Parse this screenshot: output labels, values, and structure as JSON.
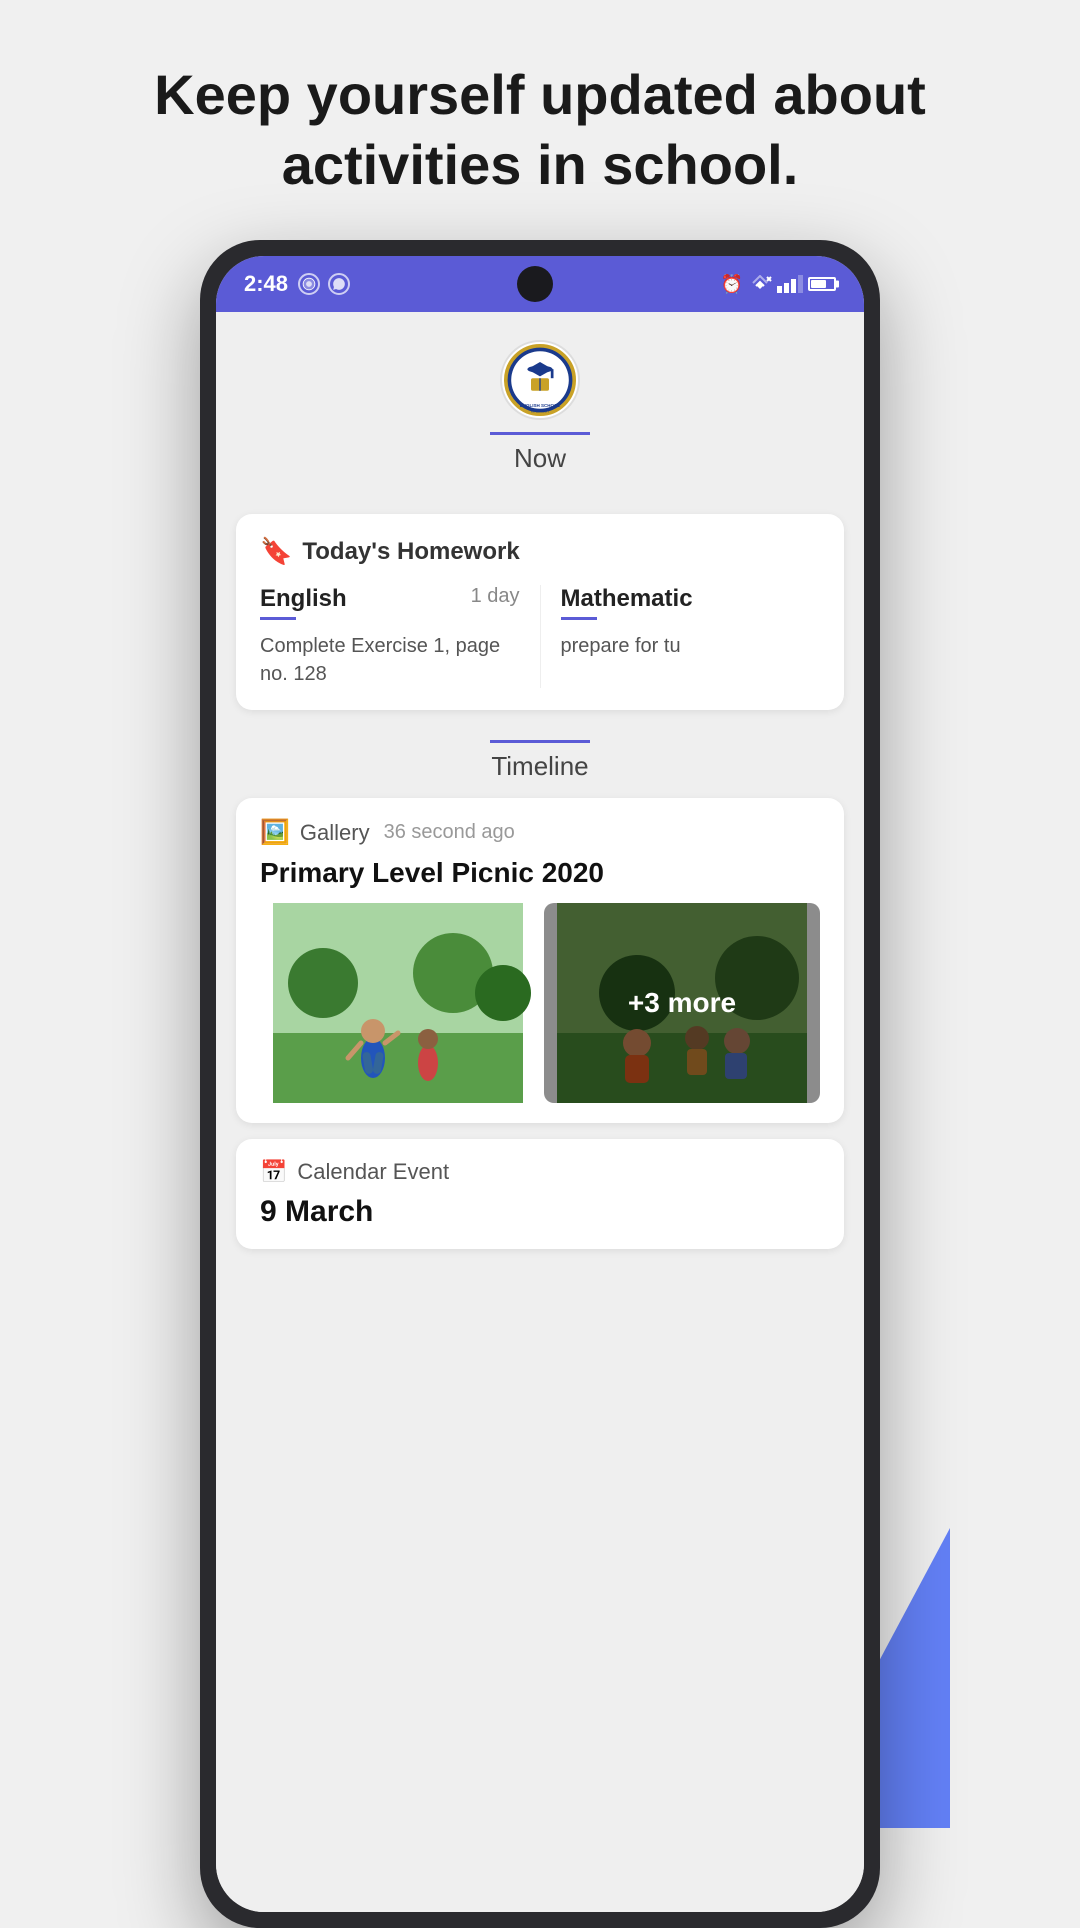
{
  "hero": {
    "text": "Keep yourself updated about activities in school."
  },
  "statusBar": {
    "time": "2:48",
    "icons": [
      "messaging-icon",
      "whatsapp-icon"
    ],
    "rightIcons": [
      "alarm-icon",
      "wifi-icon",
      "signal-icon",
      "battery-icon"
    ]
  },
  "schoolHeader": {
    "logoAlt": "School logo",
    "tabLabel": "Now"
  },
  "homeworkSection": {
    "title": "Today's Homework",
    "subjects": [
      {
        "name": "English",
        "days": "1 day",
        "description": "Complete Exercise 1, page no. 128"
      },
      {
        "name": "Mathematic",
        "days": "",
        "description": "prepare for tu"
      }
    ]
  },
  "timelineSection": {
    "tabLabel": "Timeline",
    "cards": [
      {
        "type": "Gallery",
        "timeAgo": "36 second ago",
        "title": "Primary Level Picnic 2020",
        "moreCount": "+3 more"
      },
      {
        "type": "Calendar Event",
        "date": "9 March",
        "description": ""
      }
    ]
  }
}
